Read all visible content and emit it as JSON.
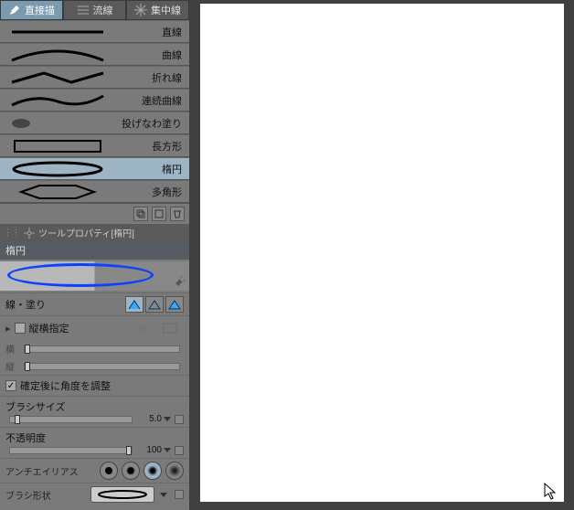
{
  "tabs": {
    "direct": "直接描",
    "stream": "流線",
    "focus": "集中線"
  },
  "shapes": {
    "line": "直線",
    "curve": "曲線",
    "polyline": "折れ線",
    "continuous_curve": "連続曲線",
    "lasso_fill": "投げなわ塗り",
    "rectangle": "長方形",
    "ellipse": "楕円",
    "polygon": "多角形"
  },
  "panel": {
    "title": "ツールプロパティ[楕円]",
    "subtool": "楕円",
    "line_fill": "線・塗り",
    "aspect_lock": "縦横指定",
    "horiz": "横",
    "vert": "縦",
    "adjust_angle": "確定後に角度を調整",
    "brush_size": "ブラシサイズ",
    "brush_size_val": "5.0",
    "opacity": "不透明度",
    "opacity_val": "100",
    "antialias": "アンチエイリアス",
    "brush_shape": "ブラシ形状"
  }
}
